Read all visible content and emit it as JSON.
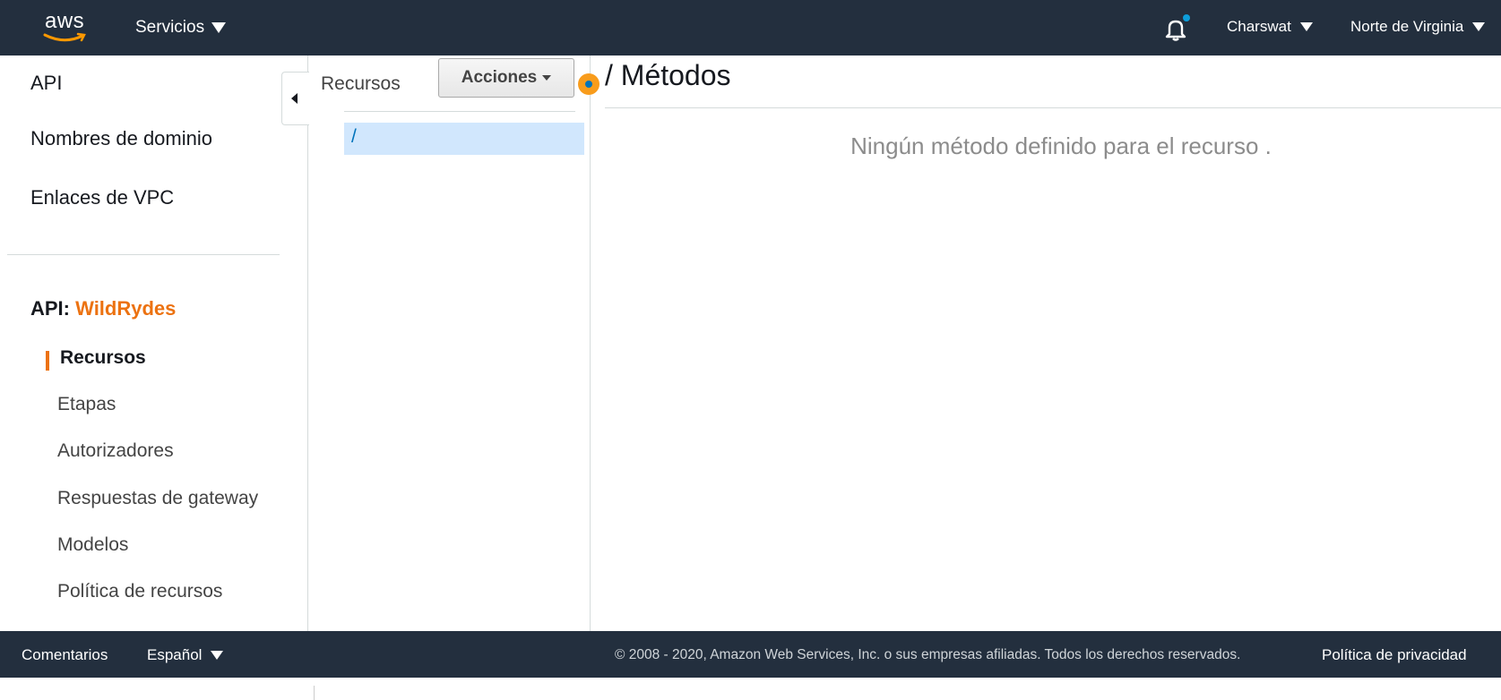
{
  "topbar": {
    "logo_text": "aws",
    "services_label": "Servicios",
    "user_label": "Charswat",
    "region_label": "Norte de Virginia",
    "notification_indicator_color": "#0d9dda"
  },
  "sidebar": {
    "top_items": [
      {
        "label": "API"
      },
      {
        "label": "Nombres de dominio"
      },
      {
        "label": "Enlaces de VPC"
      }
    ],
    "api_prefix": "API:",
    "api_name": "WildRydes",
    "sub_items": [
      {
        "label": "Recursos",
        "active": true
      },
      {
        "label": "Etapas"
      },
      {
        "label": "Autorizadores"
      },
      {
        "label": "Respuestas de gateway"
      },
      {
        "label": "Modelos"
      },
      {
        "label": "Política de recursos"
      }
    ]
  },
  "resources_pane": {
    "title": "Recursos",
    "actions_label": "Acciones",
    "selected_resource": "/"
  },
  "main": {
    "title": "/ Métodos",
    "empty_message": "Ningún método definido para el recurso ."
  },
  "footer": {
    "feedback_label": "Comentarios",
    "language_label": "Español",
    "copyright": "© 2008 - 2020, Amazon Web Services, Inc. o sus empresas afiliadas. Todos los derechos reservados.",
    "privacy_label": "Política de privacidad"
  },
  "colors": {
    "nav_bg": "#232f3e",
    "accent_orange": "#ec7211",
    "selection_bg": "#d1e7fd",
    "link_blue": "#0073bb"
  }
}
